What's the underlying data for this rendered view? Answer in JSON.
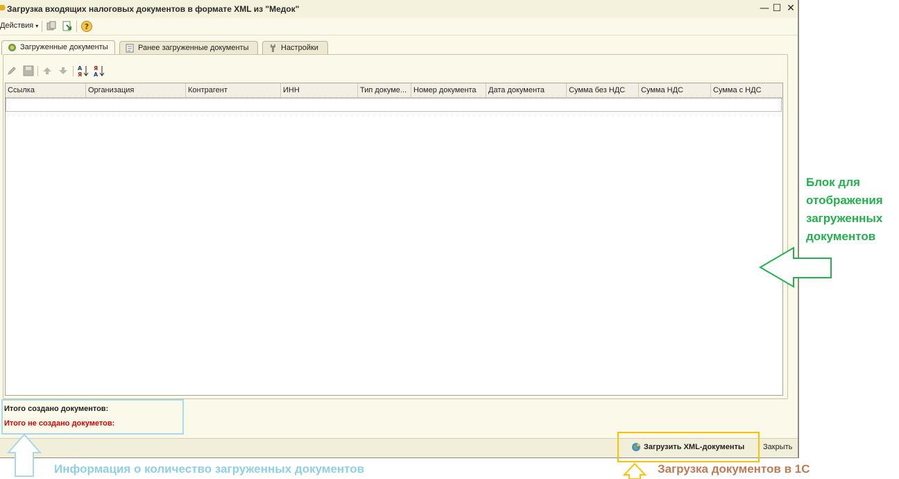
{
  "window": {
    "title": "Загрузка входящих налоговых документов в формате XML из \"Медок\"",
    "minimize_glyph": "—",
    "maximize_glyph": "☐",
    "close_glyph": "✕"
  },
  "toolbar": {
    "actions_label": "Действия",
    "icons": [
      "copy-icon",
      "load-icon",
      "help-icon"
    ]
  },
  "tabs": [
    {
      "label": "Загруженные документы",
      "icon": "load-docs-icon",
      "active": true
    },
    {
      "label": "Ранее загруженные документы",
      "icon": "docs-list-icon",
      "active": false
    },
    {
      "label": "Настройки",
      "icon": "wrench-icon",
      "active": false
    }
  ],
  "panel_toolbar": {
    "icons": [
      "edit-icon",
      "save-icon",
      "move-up-icon",
      "move-down-icon",
      "sort-asc-icon",
      "sort-desc-icon"
    ]
  },
  "table": {
    "columns": [
      "Ссылка",
      "Организация",
      "Контрагент",
      "ИНН",
      "Тип докуме...",
      "Номер документа",
      "Дата документа",
      "Сумма без НДС",
      "Сумма НДС",
      "Сумма с НДС"
    ],
    "rows": []
  },
  "summary": {
    "created": "Итого создано документов:",
    "not_created": "Итого не создано докуметов:"
  },
  "bottom": {
    "load_label": "Загрузить XML-документы",
    "close_label": "Закрыть"
  },
  "annotations": {
    "block_label": "Блок для\nотображения\nзагруженных\nдокументов",
    "info_label": "Информация о количество загруженных документов",
    "load_label": "Загрузка документов в 1С"
  },
  "colors": {
    "window_bg": "#fbf9ea",
    "annotation_green": "#22b14c",
    "annotation_blue": "#a8d8ea",
    "annotation_yellow": "#ffc000",
    "annotation_orange": "#c07a55",
    "error_red": "#e00000"
  }
}
